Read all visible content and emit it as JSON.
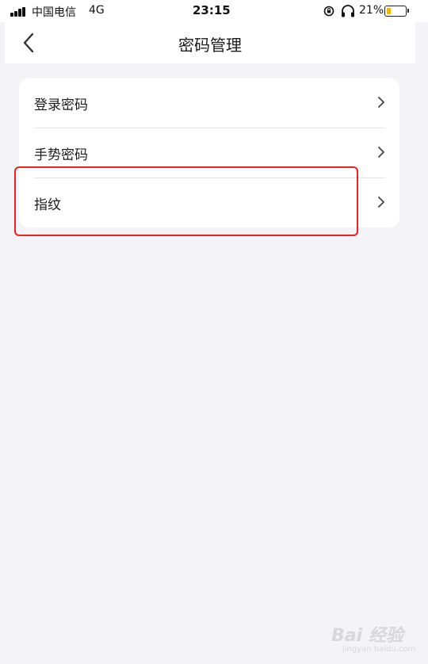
{
  "status_bar": {
    "carrier": "中国电信",
    "network": "4G",
    "time": "23:15",
    "battery_percent": "21%",
    "battery_level": 0.21,
    "battery_color": "#f2b400"
  },
  "nav": {
    "title": "密码管理",
    "back_icon": "chevron-left-icon"
  },
  "settings": {
    "items": [
      {
        "label": "登录密码",
        "icon": "chevron-right-icon"
      },
      {
        "label": "手势密码",
        "icon": "chevron-right-icon"
      },
      {
        "label": "指纹",
        "icon": "chevron-right-icon"
      }
    ]
  },
  "annotation": {
    "highlight_color": "#ee2222",
    "highlighted_item": "指纹"
  },
  "watermark": {
    "brand": "Bai 经验",
    "sub": "jingyan.baidu.com"
  }
}
